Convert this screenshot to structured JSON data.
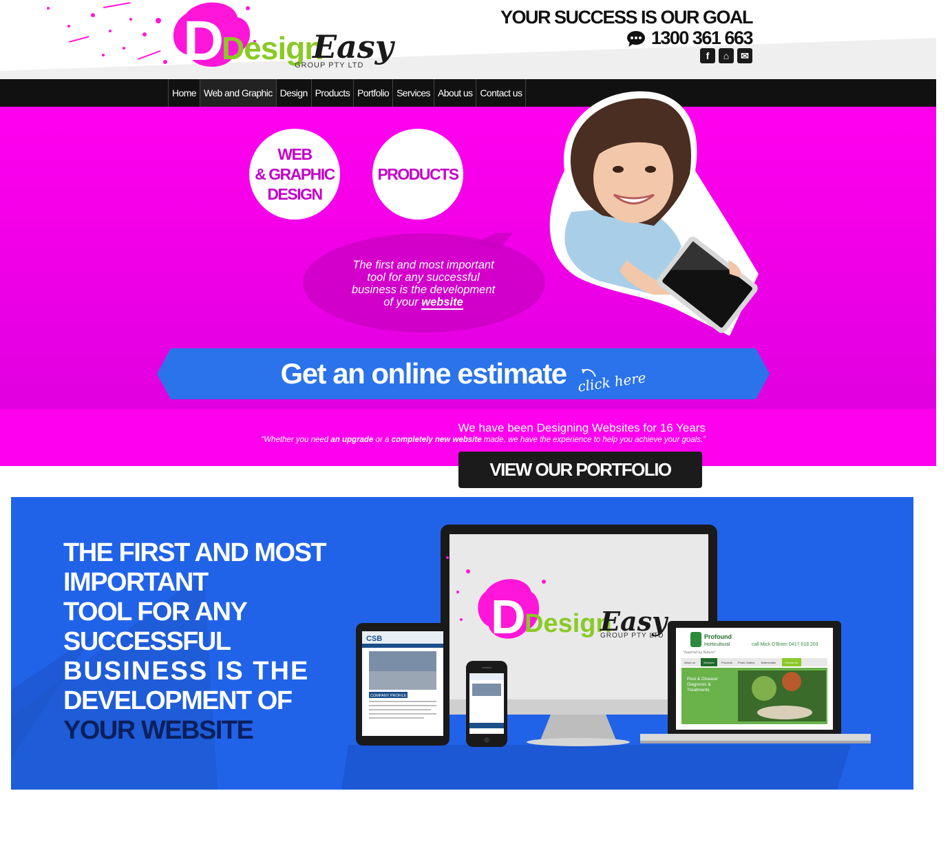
{
  "brand": {
    "logo_word1": "Design",
    "logo_word2": "Easy",
    "logo_sub": "GROUP PTY LTD",
    "colors": {
      "magenta": "#ff00ee",
      "green": "#8ac926",
      "blue": "#2163e8",
      "dark": "#111111"
    }
  },
  "header": {
    "tagline": "YOUR SUCCESS IS OUR GOAL",
    "phone": "1300 361 663",
    "social": [
      {
        "icon": "facebook-icon",
        "glyph": "f"
      },
      {
        "icon": "home-icon",
        "glyph": "⌂"
      },
      {
        "icon": "email-icon",
        "glyph": "✉"
      }
    ]
  },
  "nav": {
    "items": [
      {
        "label": "Home"
      },
      {
        "label": "Web and Graphic"
      },
      {
        "label": "Design"
      },
      {
        "label": "Products"
      },
      {
        "label": "Portfolio"
      },
      {
        "label": "Services"
      },
      {
        "label": "About us"
      },
      {
        "label": "Contact us"
      }
    ],
    "active": "Web and Graphic"
  },
  "hero": {
    "circle_web": [
      "WEB",
      "& GRAPHIC",
      "DESIGN"
    ],
    "circle_products": "PRODUCTS",
    "bubble_lines": [
      "The first and most important",
      "tool for any successful",
      "business is the development"
    ],
    "bubble_last_prefix": "of your ",
    "bubble_last_bold": "website",
    "estimate_label": "Get an online estimate",
    "estimate_click": "click here"
  },
  "band": {
    "title": "We have been Designing Websites for 16 Years",
    "quote_parts": [
      "“Whether you need ",
      "an upgrade",
      " or a ",
      "completely new website",
      " made, we have the experience to help you achieve your goals.”"
    ],
    "portfolio_button": "VIEW OUR PORTFOLIO"
  },
  "showcase": {
    "headline_lines": [
      "THE FIRST AND MOST IMPORTANT",
      "TOOL FOR ANY SUCCESSFUL",
      "BUSINESS IS THE",
      "DEVELOPMENT OF"
    ],
    "headline_dark": "YOUR WEBSITE",
    "laptop_brand": "Profound",
    "laptop_brand2": "Horticultural",
    "laptop_phone": "call Mick O'Brien 0417 618 203",
    "laptop_tagline": "\"Inspired by Nature\"",
    "laptop_menu": [
      "About us",
      "Services",
      "Products",
      "Photo Gallery",
      "Testimonials",
      "Contact us"
    ],
    "laptop_banner": [
      "Pest & Disease",
      "Diagnosis &",
      "Treatments"
    ],
    "tablet_section": "COMPANY PROFILE",
    "monitor_word1": "Design",
    "monitor_word2": "Easy",
    "monitor_sub": "GROUP PTY LTD"
  }
}
